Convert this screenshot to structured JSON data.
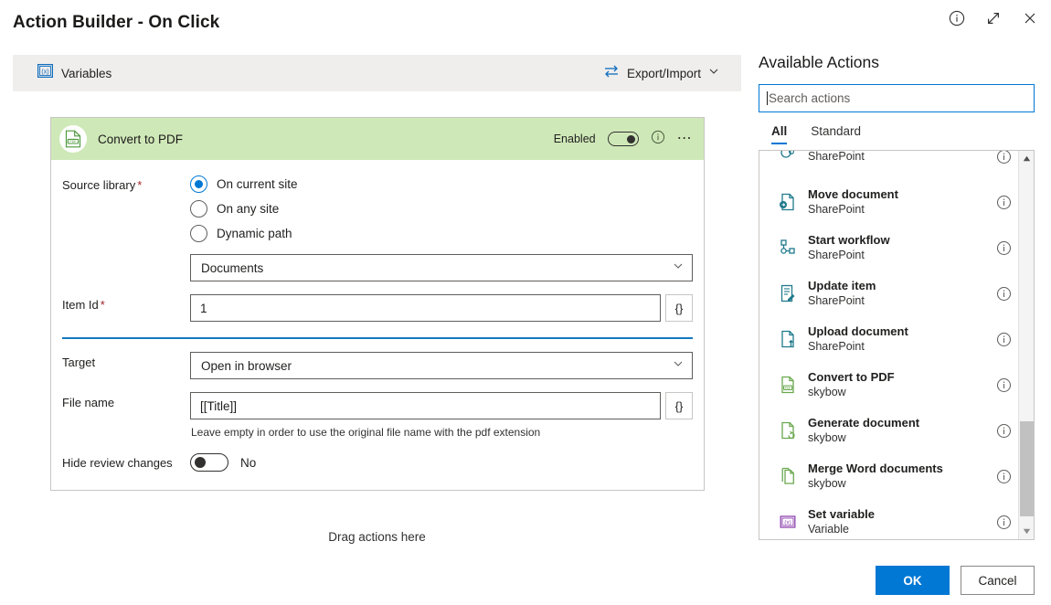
{
  "window": {
    "title": "Action Builder - On Click",
    "icons": [
      {
        "name": "info-icon",
        "glyph": "info"
      },
      {
        "name": "expand-icon",
        "glyph": "expand"
      },
      {
        "name": "close-icon",
        "glyph": "close"
      }
    ]
  },
  "toolbar": {
    "variables_label": "Variables",
    "variables_icon": "variables-icon",
    "export_import_label": "Export/Import",
    "export_import_icon": "swap-arrows-icon",
    "chevron_icon": "chevron-down-icon"
  },
  "canvas": {
    "drag_hint": "Drag actions here"
  },
  "action_card": {
    "icon": "convert-to-pdf-icon",
    "title": "Convert to PDF",
    "header_color": "#cfe8b8",
    "enabled_label": "Enabled",
    "enabled_state": "on",
    "info_icon": "info-icon",
    "more_icon": "more-ellipsis-icon",
    "fields": {
      "source_library": {
        "label": "Source library",
        "required": true,
        "options": [
          {
            "label": "On current site",
            "selected": true
          },
          {
            "label": "On any site",
            "selected": false
          },
          {
            "label": "Dynamic path",
            "selected": false
          }
        ],
        "library_select_value": "Documents"
      },
      "item_id": {
        "label": "Item Id",
        "required": true,
        "value": "1",
        "token_button": "{}"
      },
      "target": {
        "label": "Target",
        "value": "Open in browser"
      },
      "file_name": {
        "label": "File name",
        "value": "[[Title]]",
        "token_button": "{}",
        "helper": "Leave empty in order to use the original file name with the pdf extension"
      },
      "hide_review_changes": {
        "label": "Hide review changes",
        "state": "off",
        "state_label": "No"
      }
    }
  },
  "available_actions": {
    "title": "Available Actions",
    "search": {
      "placeholder": "Search actions",
      "value": "",
      "focused": true
    },
    "tabs": [
      {
        "label": "All",
        "active": true
      },
      {
        "label": "Standard",
        "active": false
      }
    ],
    "items": [
      {
        "name": "",
        "category": "SharePoint",
        "icon": "sharepoint-action-icon",
        "icon_color": "#1f7a8c",
        "clipped": true
      },
      {
        "name": "Move document",
        "category": "SharePoint",
        "icon": "move-document-icon",
        "icon_color": "#1f7a8c"
      },
      {
        "name": "Start workflow",
        "category": "SharePoint",
        "icon": "start-workflow-icon",
        "icon_color": "#1f7a8c"
      },
      {
        "name": "Update item",
        "category": "SharePoint",
        "icon": "update-item-icon",
        "icon_color": "#1f7a8c"
      },
      {
        "name": "Upload document",
        "category": "SharePoint",
        "icon": "upload-document-icon",
        "icon_color": "#1f7a8c"
      },
      {
        "name": "Convert to PDF",
        "category": "skybow",
        "icon": "convert-to-pdf-icon",
        "icon_color": "#6aa84f"
      },
      {
        "name": "Generate document",
        "category": "skybow",
        "icon": "generate-document-icon",
        "icon_color": "#6aa84f"
      },
      {
        "name": "Merge Word documents",
        "category": "skybow",
        "icon": "merge-word-documents-icon",
        "icon_color": "#6aa84f"
      },
      {
        "name": "Set variable",
        "category": "Variable",
        "icon": "set-variable-icon",
        "icon_color": "#8e44ad"
      }
    ],
    "item_info_icon": "info-icon",
    "scrollbar": {
      "up_icon": "scroll-up-arrow",
      "down_icon": "scroll-down-arrow"
    }
  },
  "footer": {
    "ok_label": "OK",
    "cancel_label": "Cancel",
    "primary_color": "#0078d4"
  }
}
